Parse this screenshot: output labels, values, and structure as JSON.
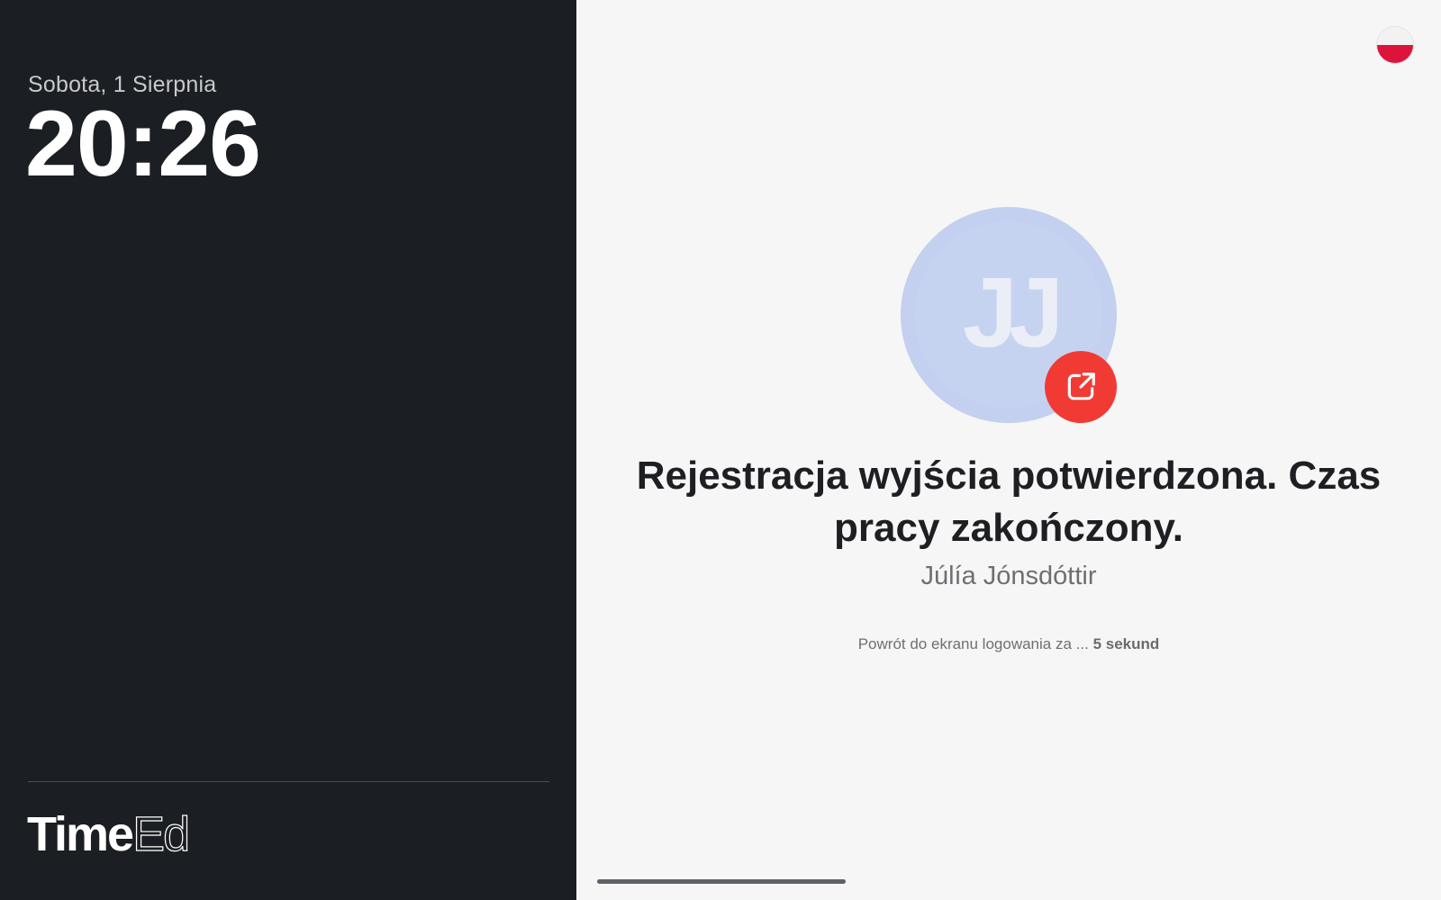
{
  "sidebar": {
    "date": "Sobota, 1 Sierpnia",
    "time": "20:26",
    "logo": {
      "part1": "Time",
      "part2": "Ed"
    }
  },
  "language": {
    "icon": "poland-flag-icon",
    "colors": [
      "#f2f2f2",
      "#dc143c"
    ]
  },
  "confirmation": {
    "avatar_initials": "JJ",
    "avatar_color": "#c6d3f0",
    "badge_icon": "external-link-icon",
    "badge_color": "#f23a34",
    "title": "Rejestracja wyjścia potwierdzona. Czas pracy zakończony.",
    "person_name": "Júlía Jónsdóttir",
    "countdown_prefix": "Powrót do ekranu logowania za ...",
    "countdown_value": "5 sekund"
  },
  "colors": {
    "sidebar_bg": "#1b1e22",
    "main_bg": "#f6f6f6"
  }
}
